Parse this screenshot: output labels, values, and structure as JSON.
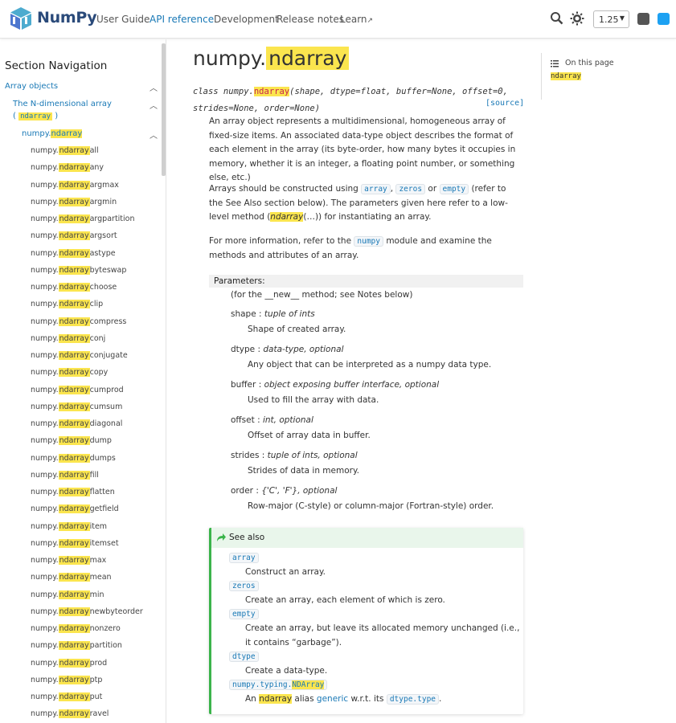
{
  "header": {
    "brand": "NumPy",
    "nav": [
      "User Guide",
      "API reference",
      "Development",
      "Release notes",
      "Learn"
    ],
    "active_nav": "API reference",
    "version": "1.25",
    "accent_color": "#1a79b6"
  },
  "sidebar": {
    "title": "Section Navigation",
    "array_objects": "Array objects",
    "ndim_array_prefix": "The N-dimensional array",
    "ndim_array_open": "(",
    "ndim_array_code": "ndarray",
    "ndim_array_close": ")",
    "current_prefix": "numpy.",
    "current_hl": "ndarray",
    "item_prefix": "numpy.",
    "item_hl": "ndarray",
    "items": [
      "all",
      "any",
      "argmax",
      "argmin",
      "argpartition",
      "argsort",
      "astype",
      "byteswap",
      "choose",
      "clip",
      "compress",
      "conj",
      "conjugate",
      "copy",
      "cumprod",
      "cumsum",
      "diagonal",
      "dump",
      "dumps",
      "fill",
      "flatten",
      "getfield",
      "item",
      "itemset",
      "max",
      "mean",
      "min",
      "newbyteorder",
      "nonzero",
      "partition",
      "prod",
      "ptp",
      "put",
      "ravel"
    ]
  },
  "main": {
    "title_prefix": "numpy.",
    "title_hl": "ndarray",
    "sig_class": "class numpy.",
    "sig_name": "ndarray",
    "sig_args1": "(shape, dtype=float, buffer=None, offset=0,",
    "sig_args2": "strides=None, order=None)",
    "source": "[source]",
    "para1": "An array object represents a multidimensional, homogeneous array of fixed-size items. An associated data-type object describes the format of each element in the array (its byte-order, how many bytes it occupies in memory, whether it is an integer, a floating point number, or something else, etc.)",
    "para2_a": "Arrays should be constructed using",
    "para2_code1": "array",
    "para2_sep1": ",",
    "para2_code2": "zeros",
    "para2_or": "or",
    "para2_code3": "empty",
    "para2_b": "(refer to the See Also section below). The parameters given here refer to a low-level method (",
    "para2_em": "ndarray",
    "para2_c": "(…)) for instantiating an array.",
    "para3_a": "For more information, refer to the",
    "para3_code": "numpy",
    "para3_b": "module and examine the methods and attributes of an array.",
    "params_label": "Parameters:",
    "params_note": "(for the __new__ method; see Notes below)",
    "params": [
      {
        "name": "shape",
        "type": "tuple of ints",
        "desc": "Shape of created array."
      },
      {
        "name": "dtype",
        "type": "data-type, optional",
        "desc": "Any object that can be interpreted as a numpy data type."
      },
      {
        "name": "buffer",
        "type": "object exposing buffer interface, optional",
        "desc": "Used to fill the array with data."
      },
      {
        "name": "offset",
        "type": "int, optional",
        "desc": "Offset of array data in buffer."
      },
      {
        "name": "strides",
        "type": "tuple of ints, optional",
        "desc": "Strides of data in memory."
      },
      {
        "name": "order",
        "type": "{'C', 'F'}, optional",
        "desc": "Row-major (C-style) or column-major (Fortran-style) order."
      }
    ],
    "param_colon": ":",
    "seealso_title": "See also",
    "seealso": [
      {
        "name": "array",
        "desc1": "Construct an array."
      },
      {
        "name": "zeros",
        "desc1": "Create an array, each element of which is zero."
      },
      {
        "name": "empty",
        "desc1": "Create an array, but leave its allocated memory unchanged (i.e.,",
        "desc2": "it contains “garbage”)."
      },
      {
        "name": "dtype",
        "desc1": "Create a data-type."
      }
    ],
    "typing_prefix": "numpy.typing.",
    "typing_hl": "NDArray",
    "typing_desc_a": "An",
    "typing_desc_hl": "ndarray",
    "typing_desc_b": "alias",
    "typing_desc_link": "generic",
    "typing_desc_c": "w.r.t. its",
    "typing_desc_code": "dtype.type",
    "typing_desc_d": "."
  },
  "on_this_page": {
    "label": "On this page",
    "link": "ndarray"
  }
}
